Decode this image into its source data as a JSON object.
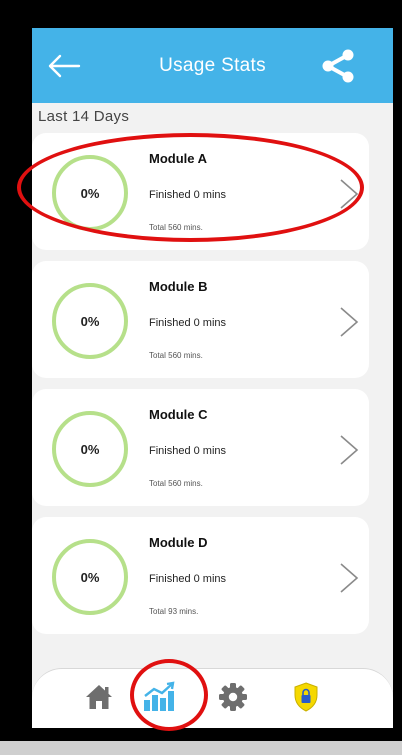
{
  "header": {
    "title": "Usage Stats",
    "back_icon": "arrow-left-icon",
    "share_icon": "share-icon",
    "color": "#44b3e8"
  },
  "section": {
    "label": "Last 14 Days"
  },
  "modules": [
    {
      "name": "Module A",
      "percent": "0%",
      "finished": "Finished 0 mins",
      "total": "Total 560 mins."
    },
    {
      "name": "Module B",
      "percent": "0%",
      "finished": "Finished 0 mins",
      "total": "Total 560 mins."
    },
    {
      "name": "Module C",
      "percent": "0%",
      "finished": "Finished 0 mins",
      "total": "Total 560 mins."
    },
    {
      "name": "Module D",
      "percent": "0%",
      "finished": "Finished 0 mins",
      "total": "Total 93 mins."
    }
  ],
  "ring_color": "#b6e08a",
  "nav": [
    {
      "icon": "home-icon",
      "active": false
    },
    {
      "icon": "stats-chart-icon",
      "active": true
    },
    {
      "icon": "settings-gear-icon",
      "active": false
    },
    {
      "icon": "security-shield-icon",
      "active": false
    }
  ],
  "nav_active_color": "#44b3e8",
  "annotation_color": "#e01010"
}
